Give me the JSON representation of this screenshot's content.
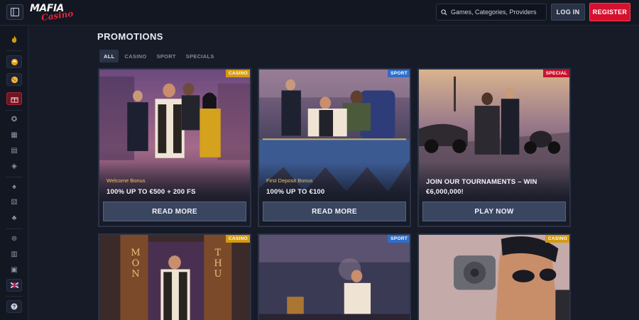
{
  "header": {
    "logo_text_top": "MAFIA",
    "logo_text_bottom": "Casino",
    "search_placeholder": "Games, Categories, Providers",
    "login_label": "LOG IN",
    "register_label": "REGISTER"
  },
  "sidebar": {
    "icons": [
      "flame-icon",
      "coin-icon",
      "pizza-icon",
      "gift-icon",
      "chip-icon",
      "shop-icon",
      "store-icon",
      "diamond-icon",
      "spade-icon",
      "dice-icon",
      "clover-icon",
      "roulette-icon",
      "slot-icon",
      "tv-icon",
      "flag-icon",
      "help-icon"
    ]
  },
  "main": {
    "title": "PROMOTIONS",
    "tabs": [
      {
        "label": "ALL",
        "active": true
      },
      {
        "label": "CASINO",
        "active": false
      },
      {
        "label": "SPORT",
        "active": false
      },
      {
        "label": "SPECIALS",
        "active": false
      }
    ],
    "cards": [
      {
        "badge": "CASINO",
        "subtitle": "Welcome Bonus",
        "offer": "100% UP TO €500 + 200 FS",
        "cta": "READ MORE"
      },
      {
        "badge": "SPORT",
        "subtitle": "First Deposit Bonus",
        "offer": "100% UP TO €100",
        "cta": "READ MORE"
      },
      {
        "badge": "SPECIAL",
        "subtitle": "",
        "offer": "JOIN OUR TOURNAMENTS – WIN €6,000,000!",
        "cta": "PLAY NOW"
      },
      {
        "badge": "CASINO",
        "mon": "MON",
        "thu": "THU"
      },
      {
        "badge": "SPORT"
      },
      {
        "badge": "CASINO"
      }
    ]
  },
  "colors": {
    "background": "#161b27",
    "accent_red": "#d6102f",
    "casino_badge": "#d49a12",
    "sport_badge": "#2f6ec9",
    "special_badge": "#c8132f"
  }
}
